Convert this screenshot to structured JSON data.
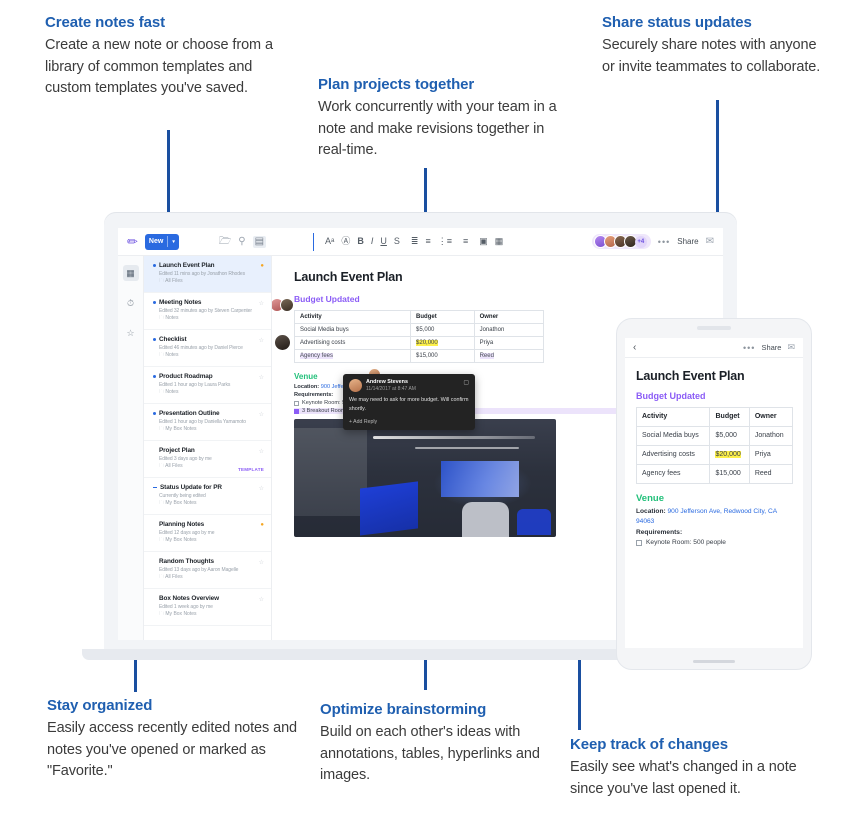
{
  "callouts": [
    {
      "id": "create-notes-fast",
      "title": "Create notes fast",
      "body": "Create a new note or choose from a library of common templates and custom templates you've saved."
    },
    {
      "id": "plan-projects-together",
      "title": "Plan projects together",
      "body": "Work concurrently with your team in a note and make revisions together in real-time."
    },
    {
      "id": "share-status-updates",
      "title": "Share status updates",
      "body": "Securely share notes with anyone or invite teammates to collaborate."
    },
    {
      "id": "stay-organized",
      "title": "Stay organized",
      "body": "Easily access recently edited notes and notes you've opened or marked as \"Favorite.\""
    },
    {
      "id": "optimize-brainstorming",
      "title": "Optimize brainstorming",
      "body": "Build on each other's ideas with annotations, tables, hyperlinks and images."
    },
    {
      "id": "keep-track-of-changes",
      "title": "Keep track of changes",
      "body": "Easily see what's changed in a note since you've last opened it."
    }
  ],
  "colors": {
    "accent_blue": "#1a4fa0",
    "heading_blue": "#1f5fb0",
    "brand_button": "#2a6ae0",
    "purple": "#8b5cf6",
    "green": "#22c07a",
    "highlight_yellow": "#fdf04a",
    "star_orange": "#f5a623"
  },
  "laptop": {
    "toolbar": {
      "brand_icon": "pencil-logo-icon",
      "new_button": "New",
      "new_caret": "▾",
      "icons": [
        "folder-icon",
        "search-icon",
        "sidebar-toggle-icon"
      ],
      "format_icons": [
        "font-size-icon",
        "text-color-icon",
        "bold-icon",
        "italic-icon",
        "underline-icon",
        "strikethrough-icon",
        "checklist-icon",
        "numbered-list-icon",
        "bulleted-list-icon",
        "align-icon",
        "image-icon",
        "table-icon"
      ],
      "avatar_overflow": "+4",
      "more_icon": "•••",
      "share_label": "Share",
      "comment_icon": "comment-icon"
    },
    "rail": [
      {
        "name": "all-files-icon",
        "glyph": "▤",
        "active": true
      },
      {
        "name": "recents-clock-icon",
        "glyph": "◷",
        "active": false
      },
      {
        "name": "favorites-star-icon",
        "glyph": "☆",
        "active": false
      }
    ],
    "notes": [
      {
        "title": "Launch Event Plan",
        "meta": "Edited 11 mins ago by Jonathon Rhodes",
        "folder": "All Files",
        "selected": true,
        "unread": true,
        "starred_on": true,
        "marker": "dot",
        "template": ""
      },
      {
        "title": "Meeting Notes",
        "meta": "Edited 32 minutes ago by Steven Carpenter",
        "folder": "Notes",
        "selected": false,
        "unread": true,
        "starred_on": false,
        "marker": "dot",
        "template": ""
      },
      {
        "title": "Checklist",
        "meta": "Edited 46 minutes ago by Daniel Pierce",
        "folder": "Notes",
        "selected": false,
        "unread": true,
        "starred_on": false,
        "marker": "dot",
        "template": ""
      },
      {
        "title": "Product Roadmap",
        "meta": "Edited 1 hour ago by Laura Parks",
        "folder": "Notes",
        "selected": false,
        "unread": true,
        "starred_on": false,
        "marker": "dot",
        "template": ""
      },
      {
        "title": "Presentation Outline",
        "meta": "Edited 1 hour ago by Daniella Yamamoto",
        "folder": "My Box Notes",
        "selected": false,
        "unread": true,
        "starred_on": false,
        "marker": "dot",
        "template": ""
      },
      {
        "title": "Project Plan",
        "meta": "Edited 3 days ago by me",
        "folder": "All Files",
        "selected": false,
        "unread": false,
        "starred_on": false,
        "marker": "none",
        "template": "TEMPLATE"
      },
      {
        "title": "Status Update for PR",
        "meta": "Currently being edited",
        "folder": "My Box Notes",
        "selected": false,
        "unread": false,
        "starred_on": false,
        "marker": "dash",
        "template": ""
      },
      {
        "title": "Planning Notes",
        "meta": "Edited 12 days ago by me",
        "folder": "My Box Notes",
        "selected": false,
        "unread": false,
        "starred_on": true,
        "marker": "none",
        "template": ""
      },
      {
        "title": "Random Thoughts",
        "meta": "Edited 13 days ago by Aaron Magelle",
        "folder": "All Files",
        "selected": false,
        "unread": false,
        "starred_on": false,
        "marker": "none",
        "template": ""
      },
      {
        "title": "Box Notes Overview",
        "meta": "Edited 1 week ago by me",
        "folder": "My Box Notes",
        "selected": false,
        "unread": false,
        "starred_on": false,
        "marker": "none",
        "template": ""
      }
    ],
    "note": {
      "title": "Launch Event Plan",
      "subheading": "Budget Updated",
      "table": {
        "headers": [
          "Activity",
          "Budget",
          "Owner"
        ],
        "rows": [
          [
            "Social Media buys",
            "$5,000",
            "Jonathon"
          ],
          [
            "Advertising costs",
            "$20,000",
            "Priya"
          ],
          [
            "Agency fees",
            "$15,000",
            "Reed"
          ]
        ]
      },
      "venue_heading": "Venue",
      "location_label": "Location:",
      "location_value": "900 Jefferson Ave, Redwood City, CA 94063",
      "requirements_label": "Requirements:",
      "requirements": [
        {
          "text": "Keynote Room: 500 people",
          "checked": false
        },
        {
          "text": "3 Breakout Rooms",
          "checked": true
        }
      ],
      "image_alt": "venue-photo"
    },
    "comment": {
      "author": "Andrew Stevens",
      "timestamp": "11/14/2017 at 8:47 AM",
      "body": "We may need to ask for more budget. Will confirm shortly.",
      "reply_label": "+ Add Reply",
      "delete_icon": "trash-icon"
    }
  },
  "phone": {
    "toolbar": {
      "back_icon": "‹",
      "more_icon": "•••",
      "share_label": "Share",
      "comment_icon": "comment-icon"
    },
    "note": {
      "title": "Launch Event Plan",
      "subheading": "Budget Updated",
      "table": {
        "headers": [
          "Activity",
          "Budget",
          "Owner"
        ],
        "rows": [
          [
            "Social Media buys",
            "$5,000",
            "Jonathon"
          ],
          [
            "Advertising costs",
            "$20,000",
            "Priya"
          ],
          [
            "Agency fees",
            "$15,000",
            "Reed"
          ]
        ]
      },
      "venue_heading": "Venue",
      "location_label": "Location:",
      "location_value": "900 Jefferson Ave, Redwood City, CA 94063",
      "requirements_label": "Requirements:",
      "requirements": [
        {
          "text": "Keynote Room: 500 people",
          "checked": false
        }
      ]
    }
  }
}
